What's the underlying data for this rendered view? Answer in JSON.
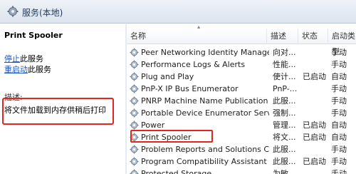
{
  "window": {
    "title": "服务(本地)"
  },
  "left_pane": {
    "service_name": "Print Spooler",
    "actions": [
      {
        "link": "停止",
        "rest": "此服务"
      },
      {
        "link": "重启动",
        "rest": "此服务"
      }
    ],
    "description_label": "描述:",
    "description": "将文件加载到内存供稍后打印"
  },
  "list": {
    "columns": [
      "名称",
      "描述",
      "状态",
      "启动类型"
    ],
    "rows": [
      {
        "name": "Peer Networking Identity Manager",
        "desc": "向对...",
        "status": "",
        "start": "手动"
      },
      {
        "name": "Performance Logs & Alerts",
        "desc": "性能...",
        "status": "",
        "start": "手动"
      },
      {
        "name": "Plug and Play",
        "desc": "使计...",
        "status": "已启动",
        "start": "自动"
      },
      {
        "name": "PnP-X IP Bus Enumerator",
        "desc": "PnP-...",
        "status": "",
        "start": "手动"
      },
      {
        "name": "PNRP Machine Name Publication S...",
        "desc": "此服...",
        "status": "",
        "start": "手动"
      },
      {
        "name": "Portable Device Enumerator Service",
        "desc": "强制...",
        "status": "",
        "start": "手动"
      },
      {
        "name": "Power",
        "desc": "管理...",
        "status": "已启动",
        "start": "自动"
      },
      {
        "name": "Print Spooler",
        "desc": "将文...",
        "status": "已启动",
        "start": "自动"
      },
      {
        "name": "Problem Reports and Solutions Co...",
        "desc": "此服...",
        "status": "",
        "start": "手动"
      },
      {
        "name": "Program Compatibility Assistant Se...",
        "desc": "此服...",
        "status": "已启动",
        "start": "手动"
      },
      {
        "name": "Protected Storage",
        "desc": "为敏...",
        "status": "",
        "start": "手动"
      }
    ]
  }
}
